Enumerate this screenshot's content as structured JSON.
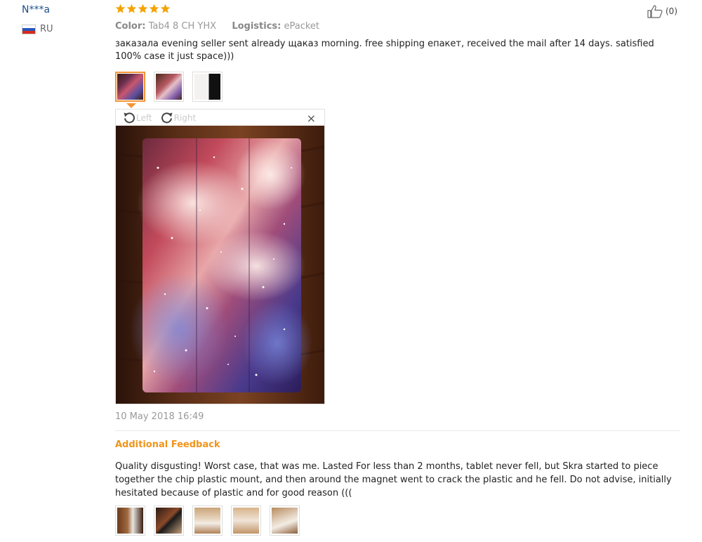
{
  "reviewer": {
    "name": "N***a",
    "country_code": "RU"
  },
  "rating": {
    "stars": 5,
    "max": 5,
    "color": "#f4a300"
  },
  "helpful": {
    "icon": "thumbs-up-icon",
    "count_label": "(0)"
  },
  "meta": {
    "color_label": "Color:",
    "color_value": "Tab4 8 CH YHX",
    "logistics_label": "Logistics:",
    "logistics_value": "ePacket"
  },
  "review_text": "заказала evening seller sent already щаказ morning. free shipping епакет, received the mail after 14 days. satisfied 100% case it just space)))",
  "photo_viewer": {
    "rotate_left_label": "Left",
    "rotate_right_label": "Right",
    "close_label": "×"
  },
  "review_date": "10 May 2018 16:49",
  "additional_feedback": {
    "title": "Additional Feedback",
    "text": "Quality disgusting! Worst case, that was me. Lasted For less than 2 months, tablet never fell, but Skra started to piece together the chip plastic mount, and then around the magnet went to crack the plastic and he fell. Do not advise, initially hesitated because of plastic and for good reason ((("
  },
  "colors": {
    "link_blue": "#1b4f8c",
    "accent_orange": "#f0941a",
    "thumb_active": "#f19535"
  }
}
